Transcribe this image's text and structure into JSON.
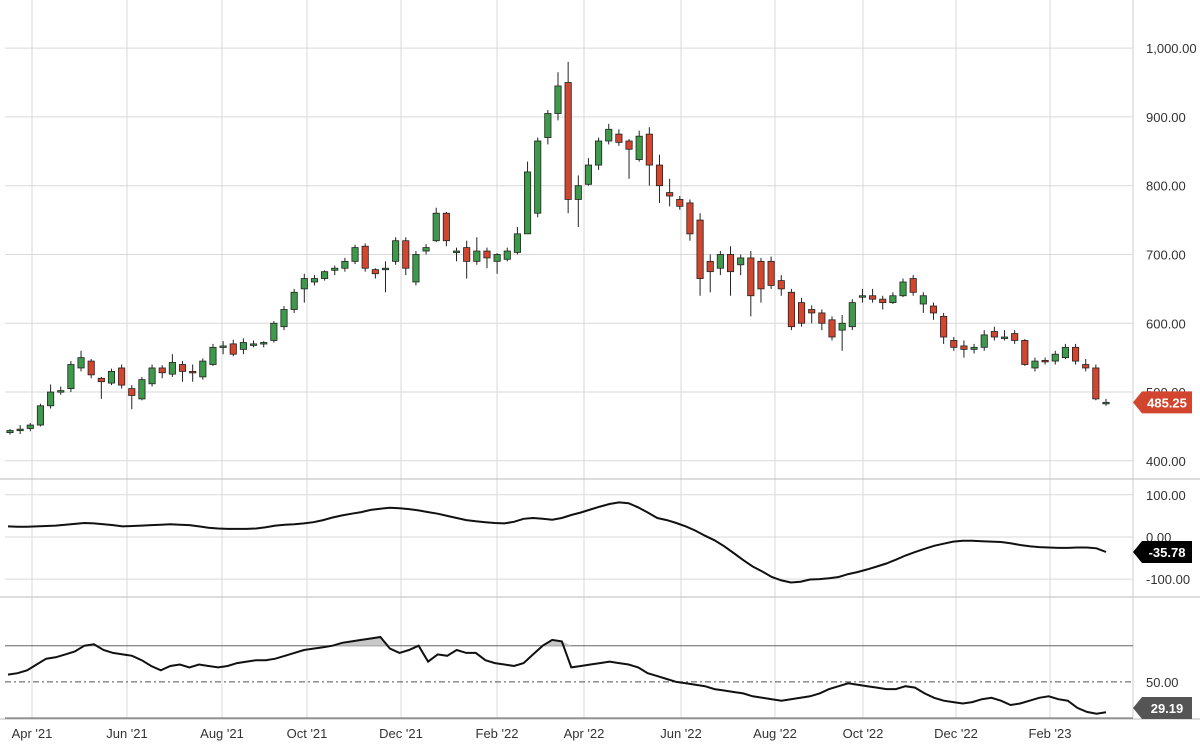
{
  "chart_data": {
    "type": "candlestick",
    "x_tick_labels": [
      "Apr '21",
      "Jun '21",
      "Aug '21",
      "Oct '21",
      "Dec '21",
      "Feb '22",
      "Apr '22",
      "Jun '22",
      "Aug '22",
      "Oct '22",
      "Dec '22",
      "Feb '23"
    ],
    "colors": {
      "up": "#3c9a4a",
      "down": "#d2462f",
      "last_price_tag": "#d2462f",
      "indicator_tag": "#000000",
      "rsi_tag": "#555555",
      "grid": "#d9d9d9"
    },
    "price": {
      "y_ticks": [
        400,
        500,
        600,
        700,
        800,
        900,
        1000
      ],
      "y_tick_labels": [
        "400.00",
        "500.00",
        "600.00",
        "700.00",
        "800.00",
        "900.00",
        "1,000.00"
      ],
      "ylim": [
        375,
        1070
      ],
      "last_value": "485.25",
      "candles": [
        [
          441,
          444,
          438,
          446
        ],
        [
          444,
          446,
          439,
          452
        ],
        [
          447,
          452,
          443,
          455
        ],
        [
          452,
          480,
          450,
          483
        ],
        [
          480,
          500,
          476,
          511
        ],
        [
          500,
          502,
          496,
          508
        ],
        [
          505,
          540,
          500,
          545
        ],
        [
          535,
          550,
          530,
          560
        ],
        [
          545,
          525,
          520,
          548
        ],
        [
          520,
          515,
          490,
          522
        ],
        [
          513,
          530,
          510,
          534
        ],
        [
          535,
          510,
          505,
          540
        ],
        [
          505,
          495,
          475,
          510
        ],
        [
          490,
          518,
          488,
          522
        ],
        [
          512,
          535,
          508,
          540
        ],
        [
          535,
          528,
          520,
          539
        ],
        [
          526,
          543,
          522,
          555
        ],
        [
          540,
          530,
          515,
          545
        ],
        [
          530,
          528,
          515,
          540
        ],
        [
          522,
          545,
          518,
          549
        ],
        [
          540,
          565,
          538,
          570
        ],
        [
          565,
          567,
          555,
          574
        ],
        [
          570,
          555,
          552,
          576
        ],
        [
          562,
          572,
          555,
          578
        ],
        [
          570,
          570,
          565,
          575
        ],
        [
          570,
          572,
          565,
          574
        ],
        [
          575,
          600,
          572,
          603
        ],
        [
          595,
          620,
          590,
          625
        ],
        [
          620,
          645,
          615,
          650
        ],
        [
          650,
          665,
          630,
          672
        ],
        [
          660,
          665,
          655,
          670
        ],
        [
          665,
          675,
          662,
          677
        ],
        [
          677,
          680,
          670,
          684
        ],
        [
          680,
          690,
          675,
          695
        ],
        [
          690,
          710,
          686,
          714
        ],
        [
          712,
          680,
          675,
          716
        ],
        [
          678,
          672,
          665,
          680
        ],
        [
          680,
          680,
          645,
          690
        ],
        [
          690,
          720,
          685,
          725
        ],
        [
          720,
          680,
          670,
          725
        ],
        [
          660,
          700,
          655,
          705
        ],
        [
          705,
          710,
          700,
          715
        ],
        [
          720,
          760,
          718,
          768
        ],
        [
          760,
          720,
          712,
          762
        ],
        [
          705,
          705,
          690,
          710
        ],
        [
          710,
          690,
          665,
          720
        ],
        [
          690,
          705,
          685,
          725
        ],
        [
          705,
          695,
          680,
          710
        ],
        [
          690,
          700,
          672,
          702
        ],
        [
          693,
          705,
          690,
          710
        ],
        [
          703,
          730,
          700,
          740
        ],
        [
          730,
          820,
          740,
          835
        ],
        [
          760,
          865,
          754,
          870
        ],
        [
          870,
          905,
          860,
          910
        ],
        [
          905,
          945,
          895,
          965
        ],
        [
          950,
          780,
          760,
          980
        ],
        [
          780,
          800,
          740,
          815
        ],
        [
          802,
          830,
          800,
          840
        ],
        [
          830,
          865,
          823,
          870
        ],
        [
          865,
          882,
          860,
          890
        ],
        [
          875,
          863,
          858,
          882
        ],
        [
          865,
          853,
          810,
          868
        ],
        [
          838,
          872,
          835,
          880
        ],
        [
          875,
          830,
          800,
          885
        ],
        [
          830,
          800,
          775,
          845
        ],
        [
          790,
          785,
          770,
          810
        ],
        [
          780,
          770,
          765,
          785
        ],
        [
          775,
          730,
          720,
          780
        ],
        [
          750,
          665,
          640,
          760
        ],
        [
          690,
          675,
          645,
          700
        ],
        [
          680,
          700,
          670,
          705
        ],
        [
          700,
          675,
          640,
          712
        ],
        [
          685,
          695,
          670,
          700
        ],
        [
          695,
          640,
          610,
          705
        ],
        [
          690,
          650,
          630,
          695
        ],
        [
          690,
          655,
          650,
          697
        ],
        [
          662,
          650,
          640,
          670
        ],
        [
          645,
          595,
          590,
          650
        ],
        [
          630,
          600,
          595,
          637
        ],
        [
          620,
          615,
          600,
          626
        ],
        [
          615,
          600,
          590,
          620
        ],
        [
          605,
          580,
          575,
          610
        ],
        [
          590,
          600,
          560,
          612
        ],
        [
          595,
          630,
          590,
          635
        ],
        [
          640,
          640,
          630,
          650
        ],
        [
          640,
          635,
          630,
          650
        ],
        [
          635,
          630,
          620,
          640
        ],
        [
          630,
          640,
          628,
          645
        ],
        [
          640,
          660,
          638,
          665
        ],
        [
          665,
          645,
          640,
          670
        ],
        [
          628,
          640,
          615,
          645
        ],
        [
          625,
          615,
          605,
          630
        ],
        [
          610,
          580,
          570,
          615
        ],
        [
          575,
          565,
          560,
          580
        ],
        [
          567,
          562,
          550,
          575
        ],
        [
          562,
          565,
          556,
          570
        ],
        [
          565,
          583,
          560,
          590
        ],
        [
          588,
          580,
          575,
          595
        ],
        [
          580,
          580,
          575,
          590
        ],
        [
          585,
          575,
          570,
          590
        ],
        [
          575,
          540,
          538,
          577
        ],
        [
          535,
          545,
          530,
          550
        ],
        [
          546,
          545,
          540,
          550
        ],
        [
          545,
          555,
          540,
          560
        ],
        [
          550,
          565,
          548,
          570
        ],
        [
          565,
          545,
          540,
          570
        ],
        [
          540,
          535,
          530,
          548
        ],
        [
          535,
          490,
          488,
          540
        ],
        [
          485,
          485,
          480,
          490
        ]
      ]
    },
    "oscillator": {
      "y_ticks": [
        100,
        0,
        -100
      ],
      "y_tick_labels": [
        "100.00",
        "0.00",
        "-100.00"
      ],
      "ylim": [
        -140,
        135
      ],
      "last_value": "-35.78",
      "values": [
        25,
        24,
        24,
        25,
        26,
        27,
        29,
        31,
        33,
        32,
        30,
        28,
        25,
        26,
        27,
        28,
        29,
        30,
        29,
        28,
        25,
        22,
        20,
        19,
        19,
        19,
        20,
        23,
        27,
        29,
        30,
        32,
        35,
        40,
        46,
        51,
        55,
        59,
        64,
        67,
        69,
        68,
        66,
        63,
        59,
        55,
        50,
        45,
        40,
        37,
        35,
        33,
        32,
        36,
        43,
        45,
        43,
        41,
        45,
        52,
        58,
        65,
        72,
        78,
        82,
        80,
        70,
        58,
        45,
        40,
        33,
        25,
        15,
        3,
        -8,
        -22,
        -38,
        -55,
        -70,
        -82,
        -95,
        -103,
        -108,
        -106,
        -101,
        -100,
        -98,
        -95,
        -88,
        -83,
        -77,
        -70,
        -63,
        -54,
        -44,
        -36,
        -28,
        -21,
        -16,
        -11,
        -9,
        -9,
        -10,
        -11,
        -12,
        -15,
        -19,
        -22,
        -24,
        -25,
        -26,
        -26,
        -25,
        -25,
        -27,
        -35.78
      ]
    },
    "rsi": {
      "y_ticks": [
        50
      ],
      "y_tick_labels": [
        "50.00"
      ],
      "ylim": [
        25,
        108
      ],
      "reference_levels": [
        75,
        50,
        25
      ],
      "last_value": "29.19",
      "values": [
        55,
        56,
        58,
        62,
        66,
        67,
        69,
        71,
        75,
        76,
        72,
        70,
        69,
        68,
        65,
        61,
        58,
        61,
        62,
        60,
        62,
        61,
        60,
        61,
        63,
        64,
        65,
        65,
        66,
        68,
        70,
        72,
        73,
        74,
        75,
        77,
        78,
        79,
        80,
        81,
        73,
        70,
        72,
        75,
        64,
        69,
        68,
        72,
        70,
        70,
        65,
        63,
        62,
        61,
        63,
        69,
        75,
        79,
        78,
        60,
        61,
        62,
        63,
        64,
        63,
        62,
        60,
        56,
        54,
        52,
        50,
        49,
        48,
        47,
        45,
        44,
        43,
        42,
        40,
        39,
        38,
        37,
        38,
        39,
        40,
        42,
        45,
        47,
        49,
        48,
        47,
        46,
        45,
        45,
        47,
        46,
        42,
        39,
        37,
        36,
        35,
        36,
        38,
        39,
        37,
        34,
        35,
        37,
        39,
        40,
        38,
        37,
        32,
        29.19,
        28,
        29
      ]
    }
  }
}
